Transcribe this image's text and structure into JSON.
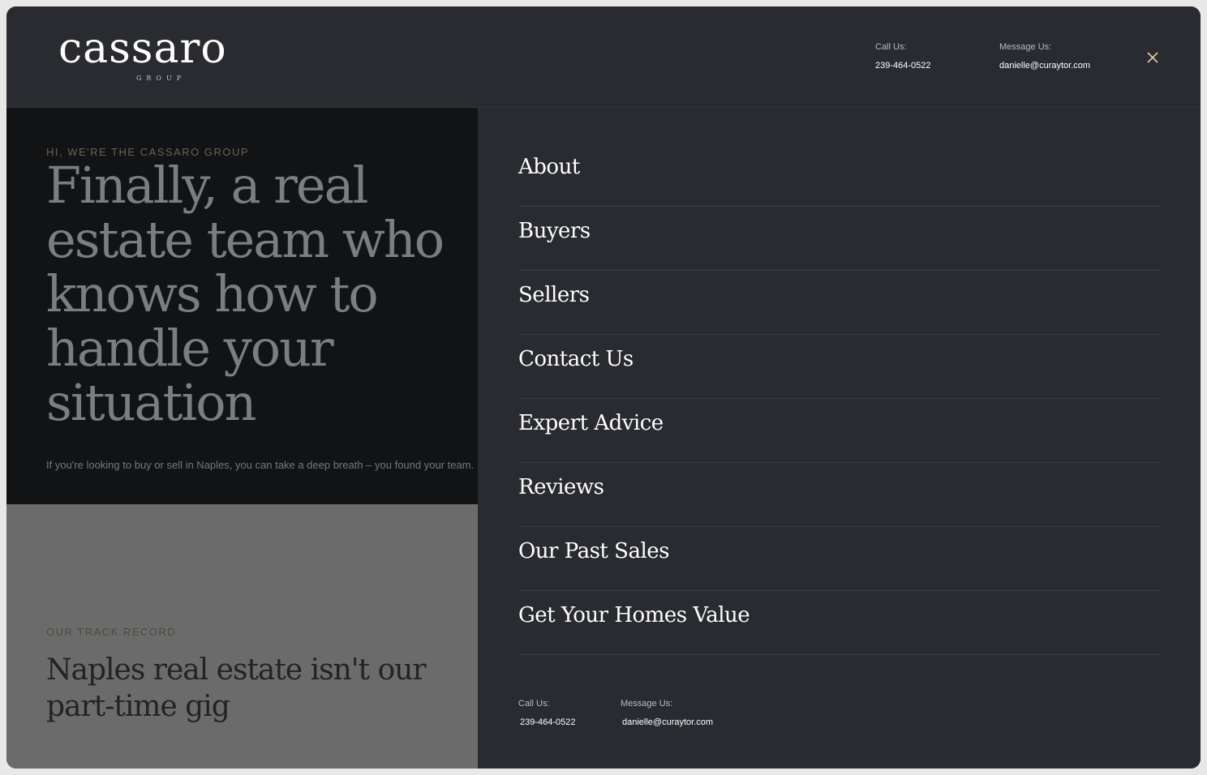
{
  "header": {
    "logo_word": "cassaro",
    "logo_sub": "GROUP",
    "call_label": "Call Us:",
    "call_value": "239-464-0522",
    "message_label": "Message Us:",
    "message_value": "danielle@curaytor.com",
    "close_icon": "close-icon"
  },
  "hero": {
    "eyebrow": "HI, WE'RE THE CASSARO GROUP",
    "title": "Finally, a real estate team who knows how to handle your situation",
    "subtitle": "If you're looking to buy or sell in Naples, you can take a deep breath – you found your team."
  },
  "track": {
    "eyebrow": "OUR TRACK RECORD",
    "title": "Naples real estate isn't our part-time gig"
  },
  "menu": {
    "items": [
      {
        "label": "About"
      },
      {
        "label": "Buyers"
      },
      {
        "label": "Sellers"
      },
      {
        "label": "Contact Us"
      },
      {
        "label": "Expert Advice"
      },
      {
        "label": "Reviews"
      },
      {
        "label": "Our Past Sales"
      },
      {
        "label": "Get Your Homes Value"
      }
    ],
    "footer": {
      "call_label": "Call Us:",
      "call_value": "239-464-0522",
      "message_label": "Message Us:",
      "message_value": "danielle@curaytor.com"
    }
  },
  "colors": {
    "panel_bg": "#292b30",
    "hero_bg": "#121315",
    "track_bg": "#6b6b6b",
    "accent_gold": "#d9c99a"
  }
}
